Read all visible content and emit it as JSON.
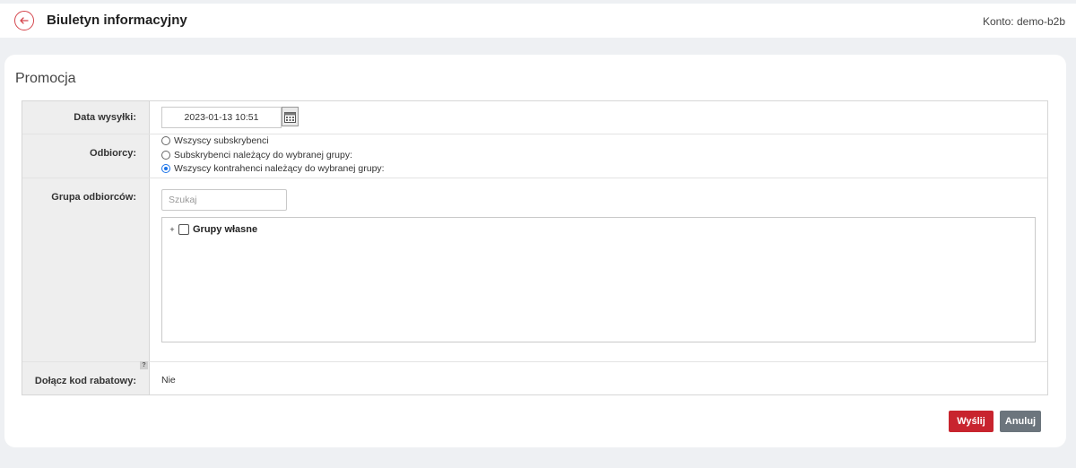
{
  "header": {
    "title": "Biuletyn informacyjny",
    "account": "Konto: demo-b2b",
    "back_icon": "arrow-left-icon"
  },
  "section": {
    "title": "Promocja"
  },
  "form": {
    "send_date": {
      "label": "Data wysyłki:",
      "value": "2023-01-13 10:51",
      "icon": "calendar-icon"
    },
    "recipients": {
      "label": "Odbiorcy:",
      "options": [
        {
          "label": "Wszyscy subskrybenci",
          "checked": false
        },
        {
          "label": "Subskrybenci należący do wybranej grupy:",
          "checked": false
        },
        {
          "label": "Wszyscy kontrahenci należący do wybranej grupy:",
          "checked": true
        }
      ]
    },
    "recipient_group": {
      "label": "Grupa odbiorców:",
      "search_placeholder": "Szukaj",
      "tree": [
        {
          "label": "Grupy własne",
          "expander": "+",
          "checked": false
        }
      ]
    },
    "discount_code": {
      "label": "Dołącz kod rabatowy:",
      "help": "?",
      "value": "Nie"
    }
  },
  "actions": {
    "send_label": "Wyślij",
    "cancel_label": "Anuluj"
  },
  "colors": {
    "accent_red": "#c8242e",
    "secondary_gray": "#6c757d",
    "radio_blue": "#1a73e8"
  }
}
